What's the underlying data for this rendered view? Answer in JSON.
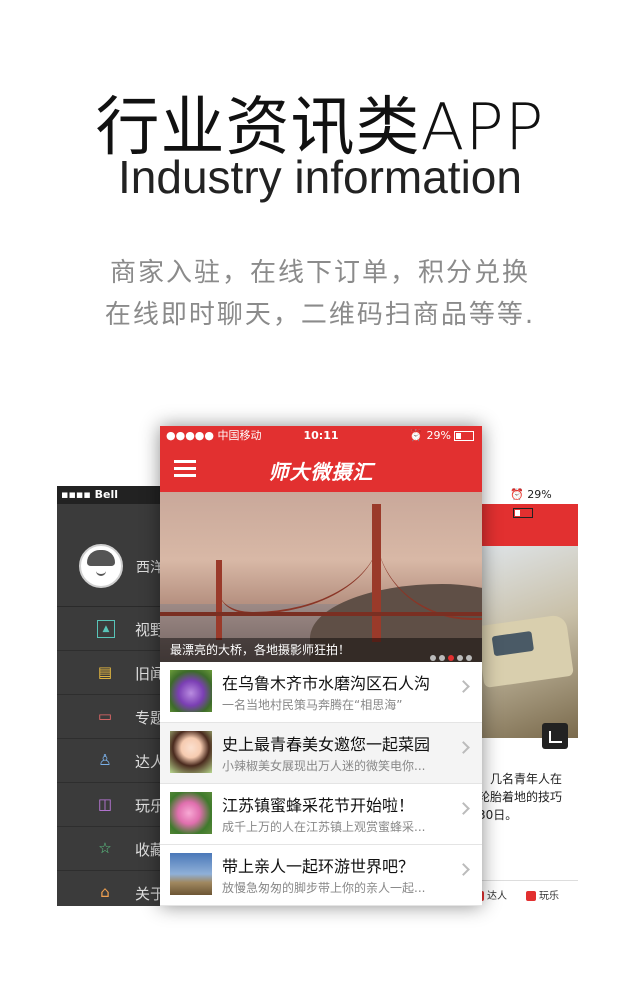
{
  "headline": {
    "title_cn": "行业资讯类APP",
    "title_en": "Industry information",
    "desc_line1": "商家入驻，在线下订单，积分兑换",
    "desc_line2": "在线即时聊天，二维码扫商品等等."
  },
  "left_phone": {
    "status": "Bell",
    "user_name": "西洋",
    "menu": [
      {
        "label": "视野",
        "icon": "image-icon"
      },
      {
        "label": "旧闻",
        "icon": "note-icon"
      },
      {
        "label": "专题",
        "icon": "chat-icon"
      },
      {
        "label": "达人",
        "icon": "user-icon"
      },
      {
        "label": "玩乐",
        "icon": "bag-icon"
      },
      {
        "label": "收藏",
        "icon": "star-icon"
      },
      {
        "label": "关于",
        "icon": "home-icon"
      }
    ]
  },
  "right_phone": {
    "status_battery": "29%",
    "text": "，几名青年人在\n轮胎着地的技巧\n30日。",
    "tabs": [
      "达人",
      "玩乐"
    ]
  },
  "center_phone": {
    "status": {
      "carrier": "●●●●● 中国移动",
      "time": "10:11",
      "battery": "29%"
    },
    "nav_title": "师大微摄汇",
    "banner": {
      "caption": "最漂亮的大桥，各地摄影师狂拍！",
      "slides": 5,
      "active_slide": 3
    },
    "news": [
      {
        "title": "在乌鲁木齐市水磨沟区石人沟",
        "subtitle": "一名当地村民策马奔腾在“相思海”"
      },
      {
        "title": "史上最青春美女邀您一起菜园",
        "subtitle": "小辣椒美女展现出万人迷的微笑电你..."
      },
      {
        "title": "江苏镇蜜蜂采花节开始啦！",
        "subtitle": "成千上万的人在江苏镇上观赏蜜蜂采..."
      },
      {
        "title": "带上亲人一起环游世界吧？",
        "subtitle": "放慢急匆匆的脚步带上你的亲人一起..."
      }
    ]
  }
}
